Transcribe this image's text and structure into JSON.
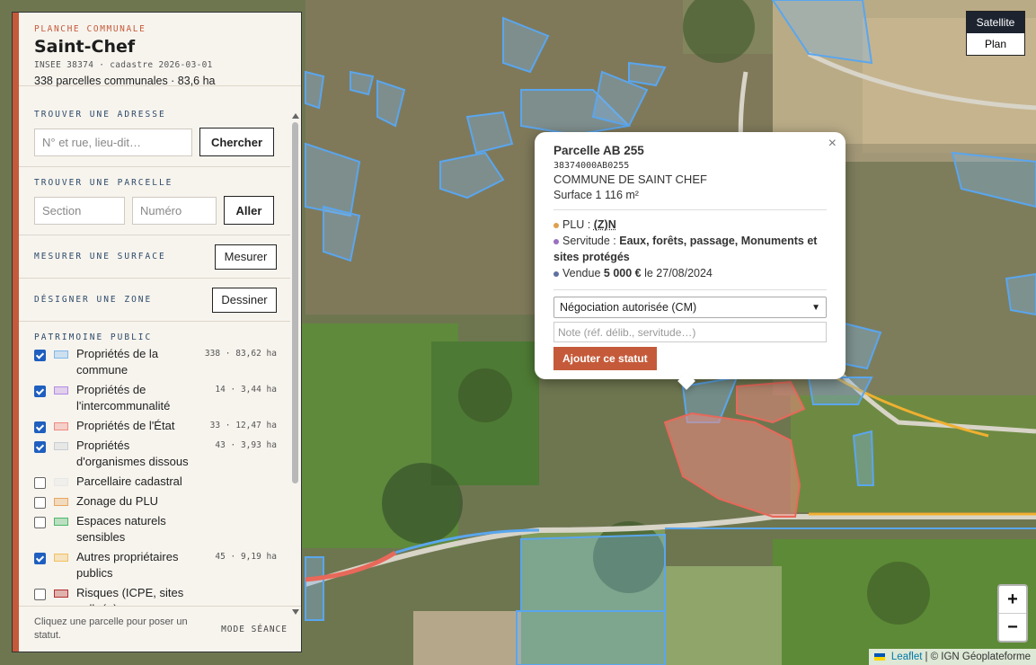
{
  "panel": {
    "kicker": "PLANCHE COMMUNALE",
    "title": "Saint-Chef",
    "meta": "INSEE 38374 · cadastre 2026-03-01",
    "summary": "338 parcelles communales · 83,6 ha"
  },
  "address": {
    "label": "TROUVER UNE ADRESSE",
    "placeholder": "N° et rue, lieu-dit…",
    "button": "Chercher"
  },
  "parcel": {
    "label": "TROUVER UNE PARCELLE",
    "section_placeholder": "Section",
    "number_placeholder": "Numéro",
    "button": "Aller"
  },
  "measure": {
    "label": "MESURER UNE SURFACE",
    "button": "Mesurer"
  },
  "zone": {
    "label": "DÉSIGNER UNE ZONE",
    "button": "Dessiner"
  },
  "patrimoine": {
    "label": "PATRIMOINE PUBLIC",
    "layers": [
      {
        "name": "Propriétés de la commune",
        "stat": "338 · 83,62 ha",
        "checked": true,
        "color": "#7fb8ee"
      },
      {
        "name": "Propriétés de l'intercommunalité",
        "stat": "14 · 3,44 ha",
        "checked": true,
        "color": "#b38be8"
      },
      {
        "name": "Propriétés de l'État",
        "stat": "33 · 12,47 ha",
        "checked": true,
        "color": "#f08a80"
      },
      {
        "name": "Propriétés d'organismes dissous",
        "stat": "43 · 3,93 ha",
        "checked": true,
        "color": "#c9ced6"
      },
      {
        "name": "Parcellaire cadastral",
        "stat": "",
        "checked": false,
        "color": "#e8e8e8"
      },
      {
        "name": "Zonage du PLU",
        "stat": "",
        "checked": false,
        "color": "#e8a860"
      },
      {
        "name": "Espaces naturels sensibles",
        "stat": "",
        "checked": false,
        "color": "#4cb86a"
      },
      {
        "name": "Autres propriétaires publics",
        "stat": "45 · 9,19 ha",
        "checked": true,
        "color": "#f2c060"
      },
      {
        "name": "Risques (ICPE, sites pollués)",
        "stat": "",
        "checked": false,
        "color": "#b03030"
      }
    ]
  },
  "footer": {
    "hint": "Cliquez une parcelle pour poser un statut.",
    "mode": "MODE SÉANCE"
  },
  "basemap": {
    "options": [
      "Satellite",
      "Plan"
    ],
    "active": "Satellite"
  },
  "zoom": {
    "in": "+",
    "out": "−"
  },
  "attribution": {
    "leaflet": "Leaflet",
    "source": "| © IGN Géoplateforme"
  },
  "popup": {
    "title": "Parcelle AB 255",
    "id": "38374000AB0255",
    "commune": "COMMUNE DE SAINT CHEF",
    "surface": "Surface 1 116 m²",
    "plu_label": "PLU :",
    "plu_value": "(Z)N",
    "servitude_label": "Servitude :",
    "servitude_value": "Eaux, forêts, passage, Monuments et sites protégés",
    "sale_prefix": "Vendue",
    "sale_price": "5 000 €",
    "sale_suffix": "le 27/08/2024",
    "status_select": "Négociation autorisée (CM)",
    "note_placeholder": "Note (réf. délib., servitude…)",
    "add_button": "Ajouter ce statut",
    "close": "×",
    "dot_colors": {
      "plu": "#e0a050",
      "servitude": "#9a70c0",
      "sale": "#6070a0"
    }
  }
}
